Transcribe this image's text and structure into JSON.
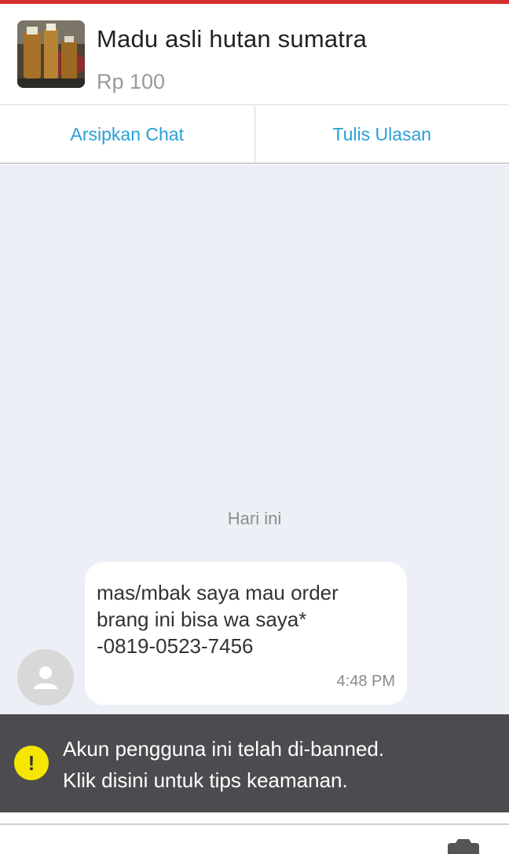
{
  "product": {
    "name": "Madu asli hutan sumatra",
    "price": "Rp 100",
    "thumbnail_icon": "honey-bottles-image"
  },
  "actions": {
    "archive_label": "Arsipkan Chat",
    "review_label": "Tulis Ulasan"
  },
  "chat": {
    "date_label": "Hari ini",
    "messages": [
      {
        "text": "mas/mbak saya mau order\nbrang ini bisa wa saya*\n-0819-0523-7456",
        "time": "4:48 PM",
        "sender_icon": "user-avatar-icon"
      }
    ]
  },
  "banner": {
    "line1": "Akun pengguna ini telah di-banned.",
    "line2": "Klik disini untuk tips keamanan.",
    "icon": "warning-icon",
    "icon_glyph": "!"
  },
  "colors": {
    "accent_red": "#d32f2f",
    "link_blue": "#2a9fd6",
    "chat_bg": "#eceff5",
    "banner_bg": "#4c4c50",
    "warning_yellow": "#f5e600"
  }
}
